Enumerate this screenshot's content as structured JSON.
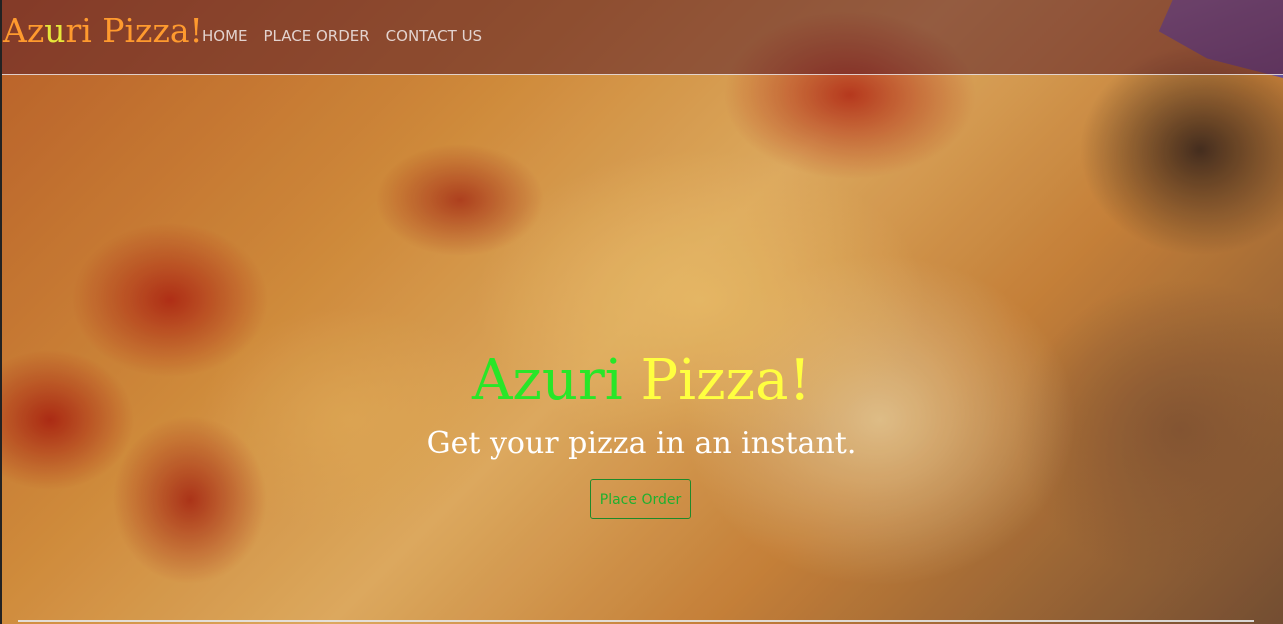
{
  "nav": {
    "brand_part1": "Az",
    "brand_part2": "u",
    "brand_part3": "ri Pizza!",
    "links": [
      {
        "label": "HOME"
      },
      {
        "label": "PLACE ORDER"
      },
      {
        "label": "CONTACT US"
      }
    ]
  },
  "hero": {
    "title_word1": "Azuri",
    "title_word2": "Pizza!",
    "subtitle": "Get your pizza in an instant.",
    "button_label": "Place Order"
  },
  "colors": {
    "brand": "#ff9a2e",
    "brand_accent": "#e7e83a",
    "title_green": "#28e628",
    "title_yellow": "#ffff40",
    "button_green": "#1fb02f",
    "navbar_overlay": "rgba(90,30,40,0.55)"
  }
}
